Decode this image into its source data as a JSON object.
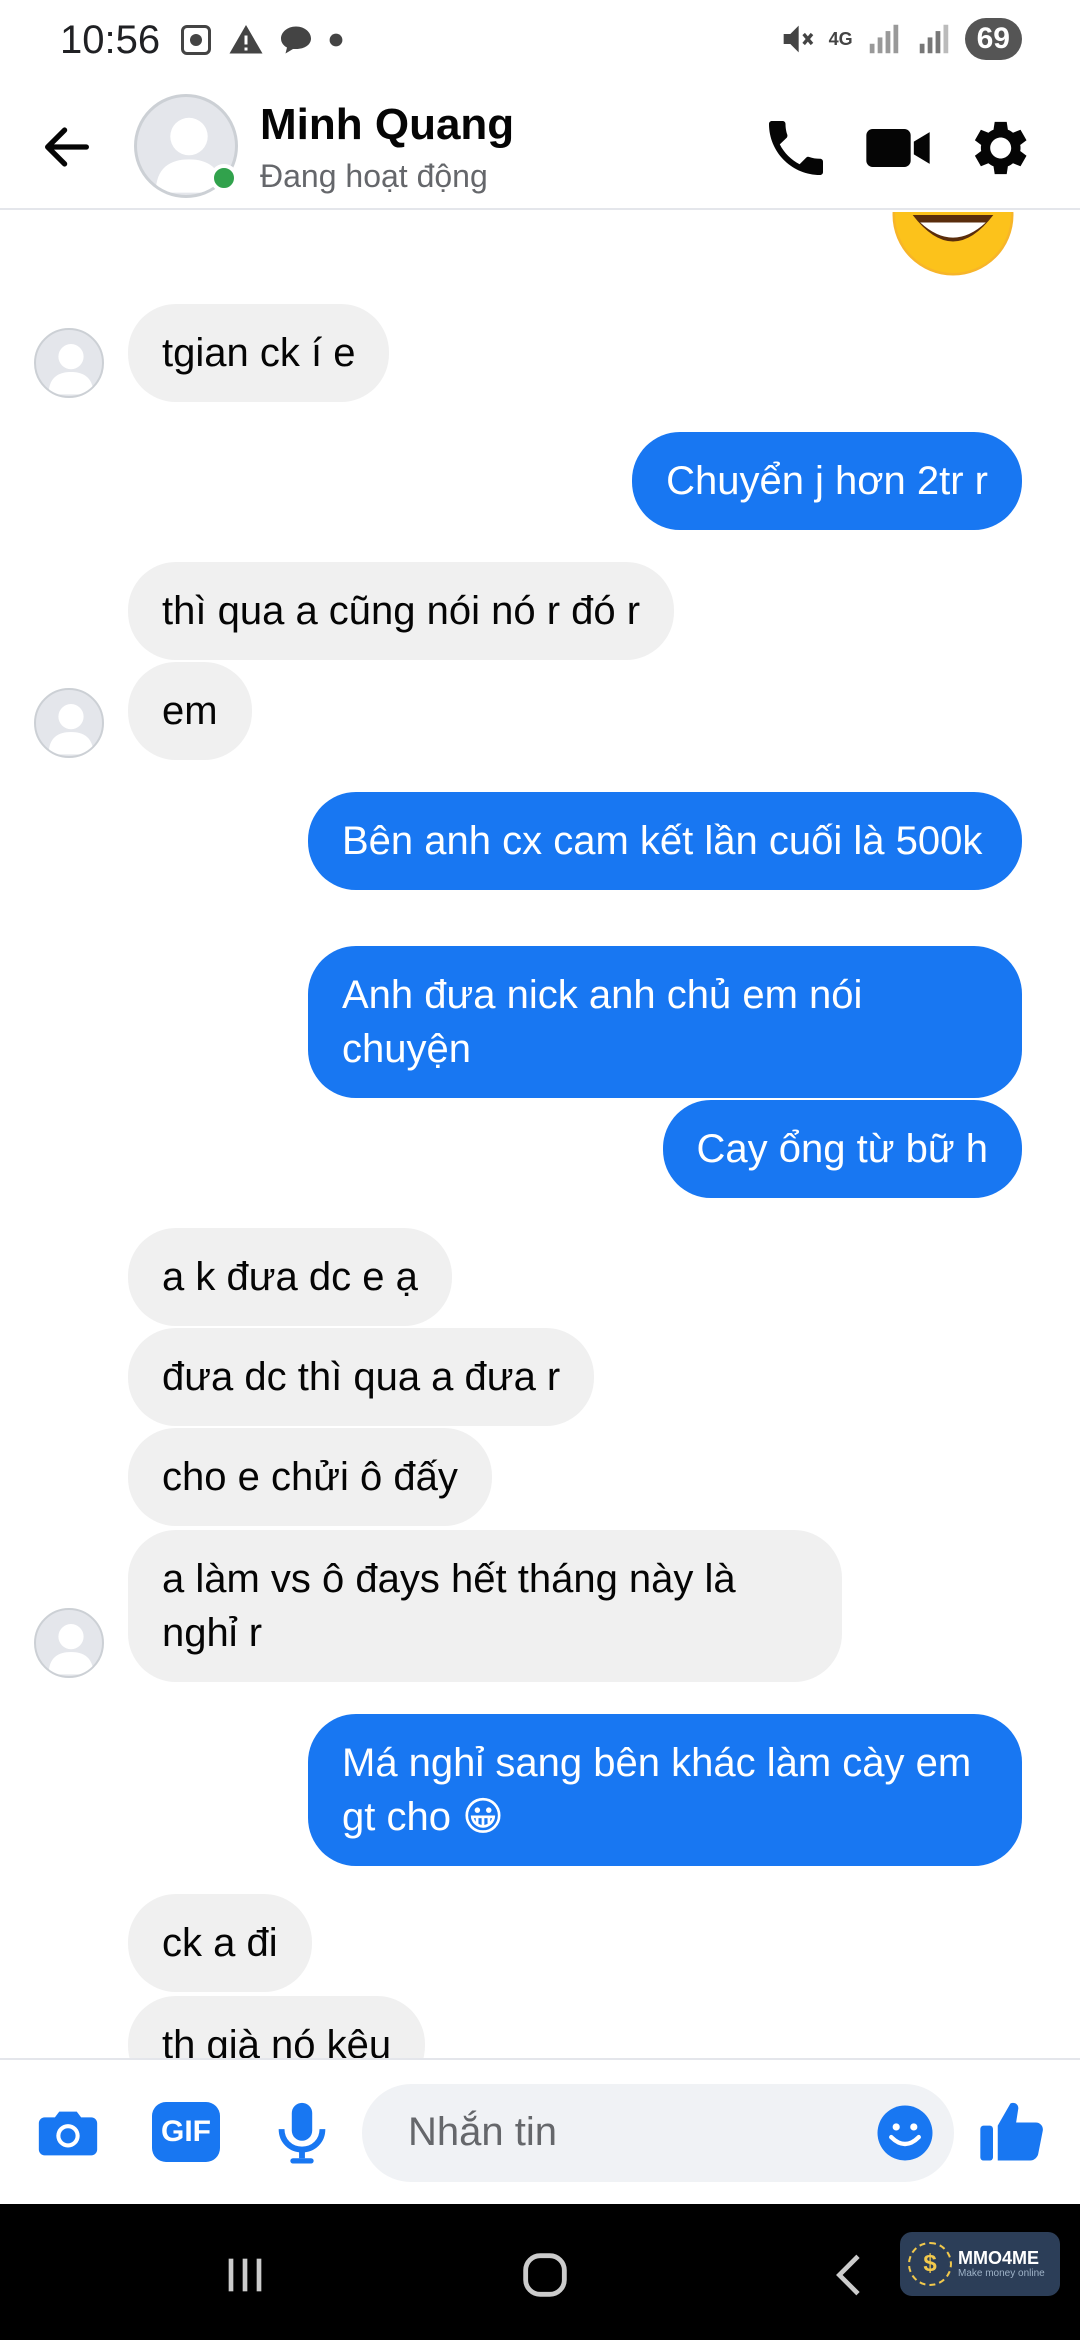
{
  "status_bar": {
    "time": "10:56",
    "battery": "69",
    "network": "4G"
  },
  "header": {
    "contact_name": "Minh Quang",
    "contact_status": "Đang hoạt động"
  },
  "messages": [
    {
      "side": "in",
      "text": "tgian ck í e"
    },
    {
      "side": "out",
      "text": "Chuyển j hơn 2tr r"
    },
    {
      "side": "in",
      "text": "thì qua a cũng nói nó r đó r"
    },
    {
      "side": "in",
      "text": "em"
    },
    {
      "side": "out",
      "text": "Bên anh cx cam kết lần cuối là 500k"
    },
    {
      "side": "out",
      "text": "Anh đưa nick anh chủ em nói chuyện"
    },
    {
      "side": "out",
      "text": "Cay ổng từ bữ h"
    },
    {
      "side": "in",
      "text": "a k đưa dc e ạ"
    },
    {
      "side": "in",
      "text": "đưa dc thì qua a đưa r"
    },
    {
      "side": "in",
      "text": "cho e chửi ô đấy"
    },
    {
      "side": "in",
      "text": "a làm vs ô đays hết tháng này là nghỉ r"
    },
    {
      "side": "out",
      "text": "Má nghỉ sang bên khác làm cày em gt cho 😀"
    },
    {
      "side": "in",
      "text": "ck a đi"
    },
    {
      "side": "in",
      "text": "th già nó kêu"
    }
  ],
  "composer": {
    "placeholder": "Nhắn tin",
    "gif_label": "GIF"
  },
  "watermark": {
    "brand": "MMO4ME",
    "tagline": "Make money online"
  },
  "colors": {
    "accent": "#1877f2",
    "incoming_bubble": "#f0f0f0",
    "online": "#31a24c"
  }
}
